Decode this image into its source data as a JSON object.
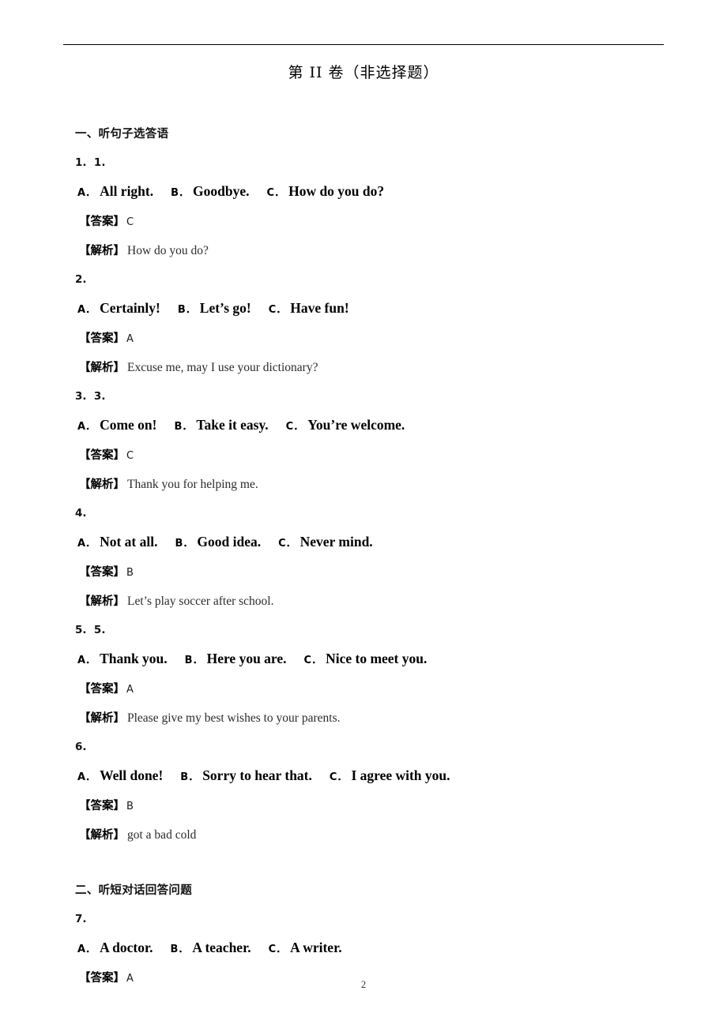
{
  "document": {
    "title": "第 II 卷（非选择题）",
    "page_number": "2",
    "answer_tag": "【答案】",
    "analysis_tag": "【解析】"
  },
  "sections": [
    {
      "heading": "一、听句子选答语",
      "questions": [
        {
          "number": "1.  1.",
          "options": [
            {
              "letter": "A．",
              "text": "All right."
            },
            {
              "letter": "B．",
              "text": "Goodbye."
            },
            {
              "letter": "C．",
              "text": "How do you do?"
            }
          ],
          "answer": "C",
          "analysis": "How do you do?"
        },
        {
          "number": "2.",
          "options": [
            {
              "letter": "A．",
              "text": "Certainly!"
            },
            {
              "letter": "B．",
              "text": "Let’s go!"
            },
            {
              "letter": "C．",
              "text": "Have fun!"
            }
          ],
          "answer": "A",
          "analysis": "Excuse me, may I use your dictionary?"
        },
        {
          "number": "3.  3.",
          "options": [
            {
              "letter": "A．",
              "text": "Come on!"
            },
            {
              "letter": "B．",
              "text": "Take it easy."
            },
            {
              "letter": "C．",
              "text": "You’re welcome."
            }
          ],
          "answer": "C",
          "analysis": "Thank you for helping me."
        },
        {
          "number": "4.",
          "options": [
            {
              "letter": "A．",
              "text": "Not at all."
            },
            {
              "letter": "B．",
              "text": "Good idea."
            },
            {
              "letter": "C．",
              "text": "Never mind."
            }
          ],
          "answer": "B",
          "analysis": "Let’s play soccer after school."
        },
        {
          "number": "5.  5.",
          "options": [
            {
              "letter": "A．",
              "text": "Thank you."
            },
            {
              "letter": "B．",
              "text": "Here you are."
            },
            {
              "letter": "C．",
              "text": "Nice to meet you."
            }
          ],
          "answer": "A",
          "analysis": "Please give my best wishes to your parents."
        },
        {
          "number": "6.",
          "options": [
            {
              "letter": "A．",
              "text": "Well done!"
            },
            {
              "letter": "B．",
              "text": "Sorry to hear that."
            },
            {
              "letter": "C．",
              "text": "I agree with you."
            }
          ],
          "answer": "B",
          "analysis": "got a bad cold"
        }
      ]
    },
    {
      "heading": "二、听短对话回答问题",
      "questions": [
        {
          "number": "7.",
          "options": [
            {
              "letter": "A．",
              "text": "A doctor."
            },
            {
              "letter": "B．",
              "text": "A teacher."
            },
            {
              "letter": "C．",
              "text": "A writer."
            }
          ],
          "answer": "A",
          "analysis": null
        }
      ]
    }
  ]
}
